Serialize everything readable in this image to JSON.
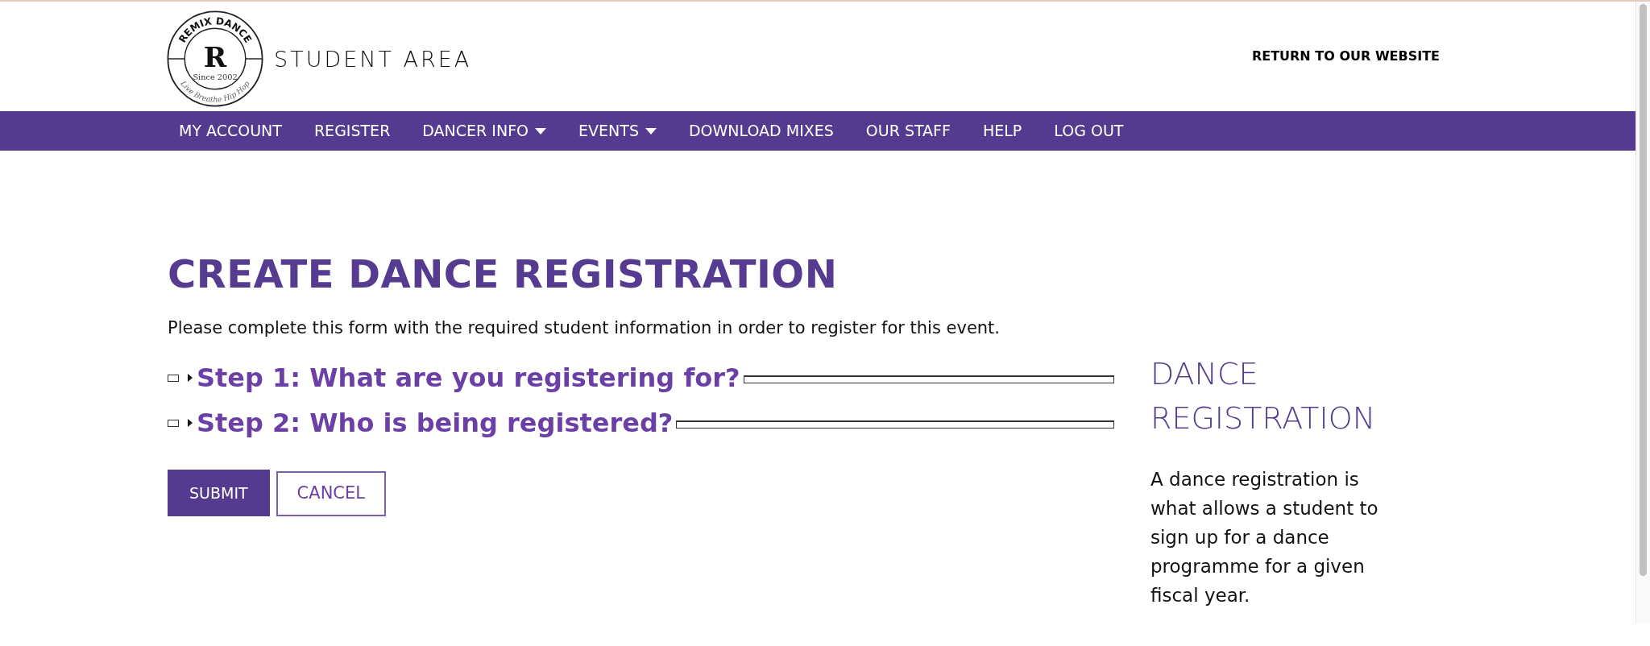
{
  "logo": {
    "ring_text": "REMIX DANCE",
    "letter": "R",
    "since": "Since 2002",
    "motto": "Live Breathe Hip Hop"
  },
  "site_title": "STUDENT AREA",
  "return_link": "RETURN TO OUR WEBSITE",
  "nav": [
    {
      "label": "MY ACCOUNT",
      "dropdown": false
    },
    {
      "label": "REGISTER",
      "dropdown": false
    },
    {
      "label": "DANCER INFO",
      "dropdown": true
    },
    {
      "label": "EVENTS",
      "dropdown": true
    },
    {
      "label": "DOWNLOAD MIXES",
      "dropdown": false
    },
    {
      "label": "OUR STAFF",
      "dropdown": false
    },
    {
      "label": "HELP",
      "dropdown": false
    },
    {
      "label": "LOG OUT",
      "dropdown": false
    }
  ],
  "heading": "CREATE DANCE REGISTRATION",
  "intro": "Please complete this form with the required student information in order to register for this event.",
  "steps": [
    {
      "title": "Step 1: What are you registering for?",
      "expanded": false
    },
    {
      "title": "Step 2: Who is being registered?",
      "expanded": false
    }
  ],
  "buttons": [
    {
      "label": "SUBMIT",
      "kind": "primary"
    },
    {
      "label": "CANCEL",
      "kind": "outline"
    }
  ],
  "sidebar": {
    "title": "DANCE REGISTRATION",
    "text": "A dance registration is what allows a student to sign up for a dance programme for a given fiscal year."
  }
}
